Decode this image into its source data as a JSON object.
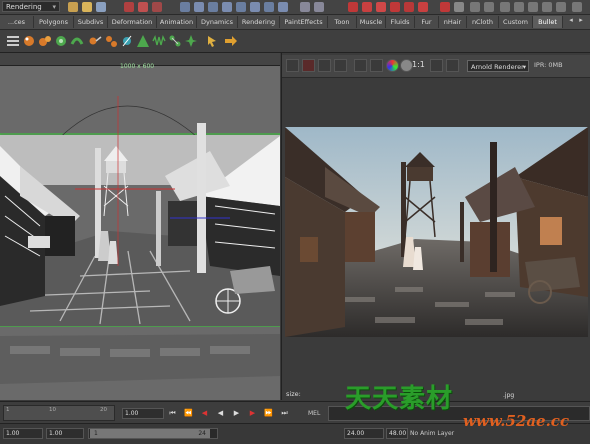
{
  "topbar": {
    "mode": "Rendering"
  },
  "shelf_tabs": [
    "...ces",
    "Polygons",
    "Subdivs",
    "Deformation",
    "Animation",
    "Dynamics",
    "Rendering",
    "PaintEffects",
    "Toon",
    "Muscle",
    "Fluids",
    "Fur",
    "nHair",
    "nCloth",
    "Custom",
    "Bullet"
  ],
  "active_tab": "Bullet",
  "viewport": {
    "resolution": "1000 x 600"
  },
  "render_view": {
    "ratio": "1:1",
    "renderer": "Arnold Renderer",
    "ipr": "IPR: 0MB",
    "status": "size:",
    "file_ext": ".jpg"
  },
  "timeline": {
    "ticks": [
      "1",
      "10",
      "20"
    ],
    "current_frame": "1.00",
    "mel_label": "MEL"
  },
  "range": {
    "start": "1.00",
    "inner_start": "1.00",
    "handle_start": "1",
    "handle_end": "24",
    "end": "24.00",
    "outer_end": "48.00",
    "anim_layer": "No Anim Layer"
  },
  "watermark": {
    "cn": "天天素材",
    "url": "www.52ae.cc"
  }
}
